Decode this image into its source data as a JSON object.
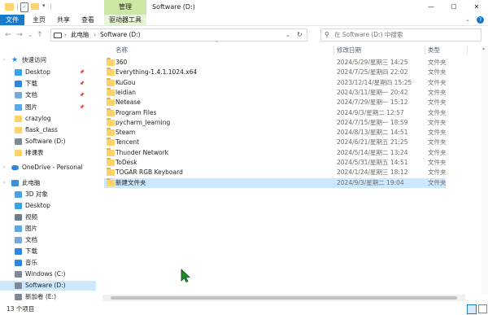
{
  "window": {
    "title": "Software (D:)",
    "context_tab_group": "管理",
    "controls": {
      "minimize": "—",
      "maximize": "☐",
      "close": "✕"
    }
  },
  "ribbon": {
    "tabs": [
      "文件",
      "主页",
      "共享",
      "查看",
      "驱动器工具"
    ],
    "colors": {
      "file_tab": "#1979ca",
      "context_header": "#cde8a4",
      "context_tab": "#e9f5d9"
    }
  },
  "address": {
    "breadcrumb": [
      "此电脑",
      "Software (D:)"
    ],
    "search_placeholder": "在 Software (D:) 中搜索"
  },
  "sidebar": {
    "items": [
      {
        "label": "快速访问",
        "icon": "star-icon",
        "color": "#2e86de",
        "level": 0
      },
      {
        "label": "Desktop",
        "icon": "desktop-icon",
        "color": "#3aa0e8",
        "level": 1,
        "pinned": true
      },
      {
        "label": "下载",
        "icon": "download-icon",
        "color": "#2e86de",
        "level": 1,
        "pinned": true
      },
      {
        "label": "文档",
        "icon": "documents-icon",
        "color": "#7aa8d8",
        "level": 1,
        "pinned": true
      },
      {
        "label": "图片",
        "icon": "pictures-icon",
        "color": "#5aa9e6",
        "level": 1,
        "pinned": true
      },
      {
        "label": "crazylog",
        "icon": "folder-icon",
        "color": "#ffd36b",
        "level": 1
      },
      {
        "label": "flask_class",
        "icon": "folder-icon",
        "color": "#ffd36b",
        "level": 1
      },
      {
        "label": "Software (D:)",
        "icon": "drive-icon",
        "color": "#7d8a96",
        "level": 1
      },
      {
        "label": "排课表",
        "icon": "folder-icon",
        "color": "#ffd36b",
        "level": 1
      },
      {
        "label": "OneDrive - Personal",
        "icon": "onedrive-icon",
        "color": "#2e86de",
        "level": 0
      },
      {
        "label": "此电脑",
        "icon": "computer-icon",
        "color": "#3d8fd6",
        "level": 0
      },
      {
        "label": "3D 对象",
        "icon": "3d-objects-icon",
        "color": "#4aa3df",
        "level": 1
      },
      {
        "label": "Desktop",
        "icon": "desktop-icon",
        "color": "#3aa0e8",
        "level": 1
      },
      {
        "label": "视频",
        "icon": "videos-icon",
        "color": "#6b7d8f",
        "level": 1
      },
      {
        "label": "图片",
        "icon": "pictures-icon",
        "color": "#5aa9e6",
        "level": 1
      },
      {
        "label": "文档",
        "icon": "documents-icon",
        "color": "#7aa8d8",
        "level": 1
      },
      {
        "label": "下载",
        "icon": "download-icon",
        "color": "#2e86de",
        "level": 1
      },
      {
        "label": "音乐",
        "icon": "music-icon",
        "color": "#2e86de",
        "level": 1
      },
      {
        "label": "Windows (C:)",
        "icon": "drive-icon",
        "color": "#7d8a96",
        "level": 1
      },
      {
        "label": "Software (D:)",
        "icon": "drive-icon",
        "color": "#7d8a96",
        "level": 1,
        "selected": true
      },
      {
        "label": "新加卷 (E:)",
        "icon": "drive-icon",
        "color": "#7d8a96",
        "level": 1
      }
    ]
  },
  "columns": {
    "name": "名称",
    "date": "修改日期",
    "type": "类型"
  },
  "files": [
    {
      "name": "360",
      "date": "2024/5/29/星期三 14:25",
      "type": "文件夹"
    },
    {
      "name": "Everything-1.4.1.1024.x64",
      "date": "2024/7/25/星期四 22:02",
      "type": "文件夹"
    },
    {
      "name": "KuGou",
      "date": "2023/12/14/星期四 15:25",
      "type": "文件夹"
    },
    {
      "name": "leidian",
      "date": "2024/3/11/星期一 20:42",
      "type": "文件夹"
    },
    {
      "name": "Netease",
      "date": "2024/7/29/星期一 15:12",
      "type": "文件夹"
    },
    {
      "name": "Program Files",
      "date": "2024/9/3/星期二 12:57",
      "type": "文件夹"
    },
    {
      "name": "pycharm_learning",
      "date": "2024/7/15/星期一 18:59",
      "type": "文件夹"
    },
    {
      "name": "Steam",
      "date": "2024/8/13/星期二 14:51",
      "type": "文件夹"
    },
    {
      "name": "Tencent",
      "date": "2024/6/21/星期五 21:25",
      "type": "文件夹"
    },
    {
      "name": "Thunder Network",
      "date": "2024/5/14/星期二 13:24",
      "type": "文件夹"
    },
    {
      "name": "ToDesk",
      "date": "2024/5/31/星期五 14:51",
      "type": "文件夹"
    },
    {
      "name": "TOGAR RGB Keyboard",
      "date": "2024/1/24/星期三 18:12",
      "type": "文件夹"
    },
    {
      "name": "新建文件夹",
      "date": "2024/9/3/星期二 19:04",
      "type": "文件夹",
      "selected": true
    }
  ],
  "status": {
    "count": "13 个项目"
  },
  "cursor": {
    "icon": "mouse-cursor-icon",
    "color": "#1e8a2e"
  }
}
